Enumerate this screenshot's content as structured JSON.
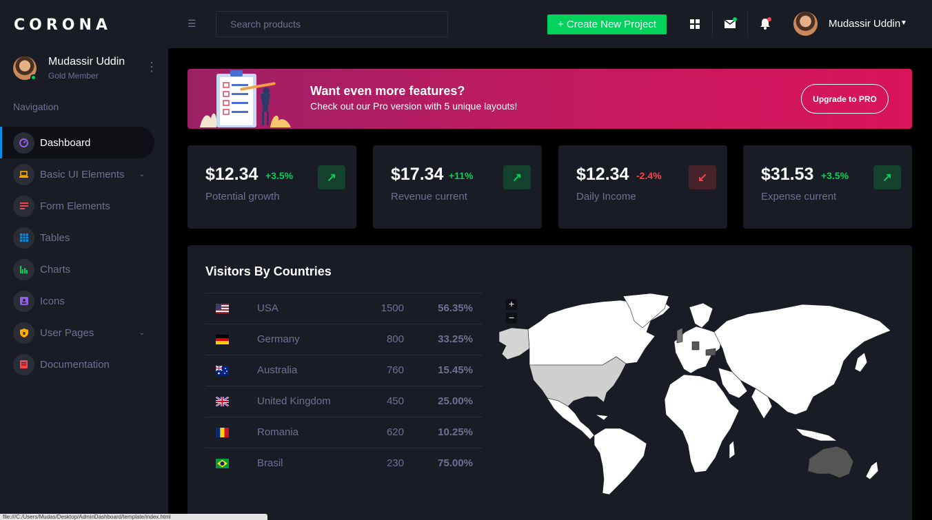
{
  "brand": "CORONA",
  "sidebar": {
    "profile": {
      "name": "Mudassir Uddin",
      "role": "Gold Member"
    },
    "nav_label": "Navigation",
    "items": [
      {
        "label": "Dashboard",
        "icon": "speedometer-icon",
        "color": "#8f5fe8"
      },
      {
        "label": "Basic UI Elements",
        "icon": "laptop-icon",
        "color": "#ffab00"
      },
      {
        "label": "Form Elements",
        "icon": "form-icon",
        "color": "#fc424a"
      },
      {
        "label": "Tables",
        "icon": "table-icon",
        "color": "#0090e7"
      },
      {
        "label": "Charts",
        "icon": "chart-icon",
        "color": "#00d25b"
      },
      {
        "label": "Icons",
        "icon": "contacts-icon",
        "color": "#8f5fe8"
      },
      {
        "label": "User Pages",
        "icon": "security-icon",
        "color": "#ffab00"
      },
      {
        "label": "Documentation",
        "icon": "document-icon",
        "color": "#fc424a"
      }
    ]
  },
  "topbar": {
    "search_placeholder": "Search products",
    "create_label": "+ Create New Project",
    "user_name": "Mudassir Uddin"
  },
  "banner": {
    "title": "Want even more features?",
    "subtitle": "Check out our Pro version with 5 unique layouts!",
    "button": "Upgrade to PRO"
  },
  "stats": [
    {
      "amount": "$12.34",
      "change": "+3.5%",
      "trend": "up",
      "label": "Potential growth"
    },
    {
      "amount": "$17.34",
      "change": "+11%",
      "trend": "up",
      "label": "Revenue current"
    },
    {
      "amount": "$12.34",
      "change": "-2.4%",
      "trend": "down",
      "label": "Daily Income"
    },
    {
      "amount": "$31.53",
      "change": "+3.5%",
      "trend": "up",
      "label": "Expense current"
    }
  ],
  "visitors": {
    "title": "Visitors By Countries",
    "rows": [
      {
        "flag": "us-flag",
        "country": "USA",
        "count": "1500",
        "percent": "56.35%"
      },
      {
        "flag": "de-flag",
        "country": "Germany",
        "count": "800",
        "percent": "33.25%"
      },
      {
        "flag": "au-flag",
        "country": "Australia",
        "count": "760",
        "percent": "15.45%"
      },
      {
        "flag": "gb-flag",
        "country": "United Kingdom",
        "count": "450",
        "percent": "25.00%"
      },
      {
        "flag": "ro-flag",
        "country": "Romania",
        "count": "620",
        "percent": "10.25%"
      },
      {
        "flag": "br-flag",
        "country": "Brasil",
        "count": "230",
        "percent": "75.00%"
      }
    ],
    "zoom_in": "+",
    "zoom_out": "−"
  },
  "statusbar": "file:///C:/Users/Mudas/Desktop/AdminDashboard/template/index.html"
}
